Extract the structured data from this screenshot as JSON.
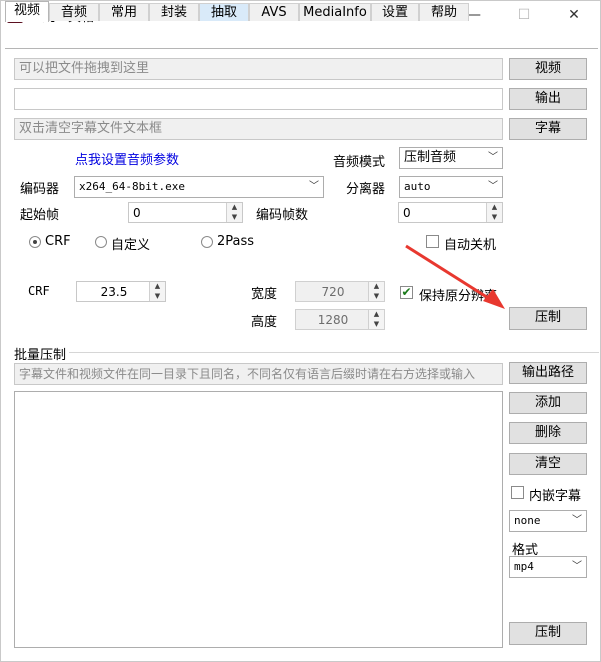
{
  "window": {
    "title": "小丸工具箱 236",
    "minimize": "—",
    "maximize": "☐",
    "close": "✕"
  },
  "tabs": [
    "视频",
    "音频",
    "常用",
    "封装",
    "抽取",
    "AVS",
    "MediaInfo",
    "设置",
    "帮助"
  ],
  "video": {
    "drop_hint": "可以把文件拖拽到这里",
    "output_value": "",
    "subtitle_hint": "双击清空字幕文件文本框",
    "btn_video": "视频",
    "btn_output": "输出",
    "btn_subtitle": "字幕",
    "audio_link": "点我设置音频参数",
    "audio_mode_label": "音频模式",
    "audio_mode_value": "压制音频",
    "encoder_label": "编码器",
    "encoder_value": "x264_64-8bit.exe",
    "splitter_label": "分离器",
    "splitter_value": "auto",
    "start_frame_label": "起始帧",
    "start_frame_value": "0",
    "encode_frames_label": "编码帧数",
    "encode_frames_value": "0",
    "radio_crf": "CRF",
    "radio_custom": "自定义",
    "radio_2pass": "2Pass",
    "auto_shutdown": "自动关机",
    "crf_label": "CRF",
    "crf_value": "23.5",
    "width_label": "宽度",
    "width_value": "720",
    "height_label": "高度",
    "height_value": "1280",
    "keep_resolution": "保持原分辨率",
    "btn_compress": "压制"
  },
  "batch": {
    "group_title": "批量压制",
    "hint": "字幕文件和视频文件在同一目录下且同名，不同名仅有语言后缀时请在右方选择或输入",
    "btn_output_path": "输出路径",
    "btn_add": "添加",
    "btn_delete": "删除",
    "btn_clear": "清空",
    "embed_sub": "内嵌字幕",
    "embed_value": "none",
    "format_label": "格式",
    "format_value": "mp4",
    "btn_compress": "压制"
  },
  "colors": {
    "accent_link": "#0000e0",
    "annotation_arrow": "#e8382f",
    "check_green": "#1a7a1a"
  }
}
